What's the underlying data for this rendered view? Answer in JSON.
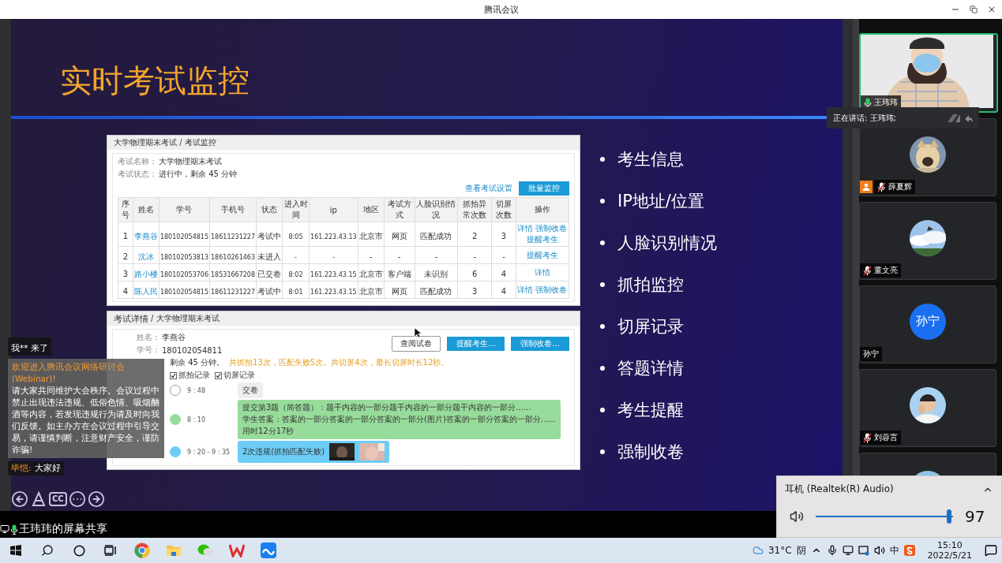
{
  "window": {
    "title": "腾讯会议"
  },
  "slide": {
    "title": "实时考试监控",
    "monitor_panel": {
      "breadcrumb": "大学物理期末考试 / 考试监控",
      "info": [
        {
          "label": "考试名称：",
          "value": "大学物理期末考试"
        },
        {
          "label": "考试状态：",
          "value": "进行中，剩余 45 分钟"
        }
      ],
      "settings_link": "查看考试设置",
      "action_button": "批量监控",
      "columns": [
        "序号",
        "姓名",
        "学号",
        "手机号",
        "状态",
        "进入时间",
        "ip",
        "地区",
        "考试方式",
        "人脸识别情况",
        "抓拍异常次数",
        "切屏次数",
        "操作"
      ],
      "rows": [
        {
          "cells": [
            "1",
            "李燕谷",
            "180102054815",
            "18611231227",
            "考试中",
            "8:05",
            "161.223.43.13",
            "北京市",
            "网页",
            "匹配成功",
            "2",
            "3"
          ],
          "actions": [
            "详情",
            "强制收卷",
            "提醒考生"
          ]
        },
        {
          "cells": [
            "2",
            "沈冰",
            "180102053813",
            "18610261463",
            "未进入",
            "-",
            "-",
            "-",
            "-",
            "-",
            "-",
            "-"
          ],
          "actions": [
            "提醒考生"
          ]
        },
        {
          "cells": [
            "3",
            "路小楼",
            "180102053706",
            "18531667208",
            "已交卷",
            "8:02",
            "161.223.43.15",
            "北京市",
            "客户端",
            "未识别",
            "6",
            "4"
          ],
          "actions": [
            "详情"
          ]
        },
        {
          "cells": [
            "4",
            "陈人民",
            "180102054815",
            "18611231227",
            "考试中",
            "8:01",
            "161.223.43.15",
            "北京市",
            "网页",
            "匹配成功",
            "3",
            "4"
          ],
          "actions": [
            "详情",
            "强制收卷"
          ]
        }
      ]
    },
    "detail_panel": {
      "title": "考试详情",
      "breadcrumb": "/ 大学物理期末考试",
      "fields": [
        {
          "label": "姓名：",
          "value": "李燕谷"
        },
        {
          "label": "学号：",
          "value": "180102054811"
        }
      ],
      "buttons": [
        {
          "label": "查阅试卷",
          "kind": "outline"
        },
        {
          "label": "提醒考生...",
          "kind": "primary"
        },
        {
          "label": "强制收卷...",
          "kind": "primary"
        }
      ],
      "status": "剩余 45 分钟。",
      "summary": "共抓拍13次，匹配失败5次。共切屏4次，最长切屏时长12秒。",
      "filters": [
        {
          "label": "抓拍记录",
          "checked": true
        },
        {
          "label": "切屏记录",
          "checked": true
        }
      ],
      "timeline": [
        {
          "time": "9 : 48",
          "kind": "plain",
          "lines": [
            "交卷"
          ]
        },
        {
          "time": "8 : 10",
          "kind": "answer",
          "lines": [
            "提交第3题（简答题）：题干内容的一部分题干内容的一部分题干内容的一部分......",
            "学生答案：答案的一部分答案的一部分答案的一部分(图片)答案的一部分答案的一部分......",
            "用时12分17秒"
          ]
        },
        {
          "time": "9 : 20 - 9 : 35",
          "kind": "violation",
          "lines": [
            "2次违规(抓拍匹配失败)"
          ]
        }
      ]
    },
    "bullets": [
      "考生信息",
      "IP地址/位置",
      "人脸识别情况",
      "抓拍监控",
      "切屏记录",
      "答题详情",
      "考生提醒",
      "强制收卷"
    ],
    "cc_label": "CC"
  },
  "share_label": "王玮玮的屏幕共享",
  "chat": [
    {
      "kind": "join",
      "text": "我** 来了"
    },
    {
      "kind": "notice",
      "title": "欢迎进入腾讯会议网络研讨会(Webinar)!",
      "text": "请大家共同维护大会秩序。会议过程中禁止出现违法违规、低俗色情、吸烟酗酒等内容，若发现违规行为请及时向我们反馈。如主办方在会议过程中引导交易，请谨慎判断，注意财产安全，谨防诈骗!"
    },
    {
      "kind": "message",
      "name": "毕恺:",
      "text": "大家好"
    }
  ],
  "participants": [
    {
      "name": "王玮玮",
      "kind": "video",
      "muted": false,
      "speaking": true,
      "host": false
    },
    {
      "name": "薛夏辉",
      "kind": "picture",
      "muted": true,
      "speaking": false,
      "host": true
    },
    {
      "name": "董文亮",
      "kind": "picture",
      "muted": true,
      "speaking": false,
      "host": false
    },
    {
      "name": "孙宁",
      "kind": "initials",
      "initials": "孙宁",
      "muted": false,
      "speaking": false,
      "host": false
    },
    {
      "name": "刘蓉言",
      "kind": "picture",
      "muted": true,
      "speaking": false,
      "host": false
    },
    {
      "kind": "picture",
      "speaking": false
    }
  ],
  "speaking_tooltip": "正在讲话: 王玮玮;",
  "volume": {
    "device": "耳机 (Realtek(R) Audio)",
    "level": 0.97,
    "reading": "97"
  },
  "taskbar": {
    "temperature": "31°C",
    "weather": "阴",
    "ime": "中",
    "time": "15:10",
    "date": "2022/5/21"
  }
}
